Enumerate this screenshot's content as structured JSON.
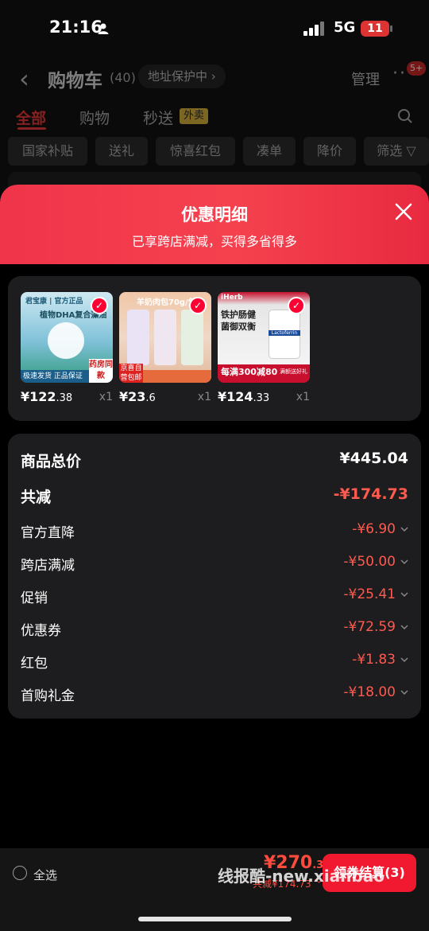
{
  "status": {
    "time": "21:16",
    "network": "5G",
    "battery": "11"
  },
  "nav": {
    "title": "购物车",
    "count": "(40)",
    "address_label": "地址保护中",
    "manage": "管理",
    "badge": "5+"
  },
  "tabs": [
    {
      "label": "全部"
    },
    {
      "label": "购物"
    },
    {
      "label": "秒送"
    }
  ],
  "tab_tag": "外卖",
  "filters": [
    {
      "label": "国家补贴"
    },
    {
      "label": "送礼"
    },
    {
      "label": "惊喜红包"
    },
    {
      "label": "凑单"
    },
    {
      "label": "降价"
    },
    {
      "label": "筛选"
    }
  ],
  "sheet": {
    "title": "优惠明细",
    "subtitle": "已享跨店满减，买得多省得多"
  },
  "products": [
    {
      "price_main": "¥122",
      "price_dec": ".38",
      "qty": "x1",
      "img_text": [
        "君宝康 | 官方正品",
        "植物DHA复合藻油",
        "极速发货 正品保证",
        "药房同款"
      ]
    },
    {
      "price_main": "¥23",
      "price_dec": ".6",
      "qty": "x1",
      "img_text": [
        "羊奶肉包70g/包",
        "京喜自营包邮"
      ]
    },
    {
      "price_main": "¥124",
      "price_dec": ".33",
      "qty": "x1",
      "img_text": [
        "iHerb",
        "铁护肠健",
        "菌御双衡",
        "Lactoferrin",
        "每满300减80",
        "满额送好礼"
      ]
    }
  ],
  "summary": {
    "total_label": "商品总价",
    "total_value": "¥445.04",
    "reduce_label": "共减",
    "reduce_value": "-¥174.73",
    "items": [
      {
        "label": "官方直降",
        "value": "-¥6.90"
      },
      {
        "label": "跨店满减",
        "value": "-¥50.00"
      },
      {
        "label": "促销",
        "value": "-¥25.41"
      },
      {
        "label": "优惠券",
        "value": "-¥72.59"
      },
      {
        "label": "红包",
        "value": "-¥1.83"
      },
      {
        "label": "首购礼金",
        "value": "-¥18.00"
      }
    ]
  },
  "bottom": {
    "select_all": "全选",
    "total_main": "¥270",
    "total_dec": ".31",
    "reduce_text": "共减¥174.73",
    "checkout": "领券结算(3)",
    "watermark": "线报酷-new.xianbao"
  },
  "colors": {
    "accent": "#f0192f",
    "discount": "#ff5a4e",
    "tab_tag_bg": "#d9b23a"
  }
}
